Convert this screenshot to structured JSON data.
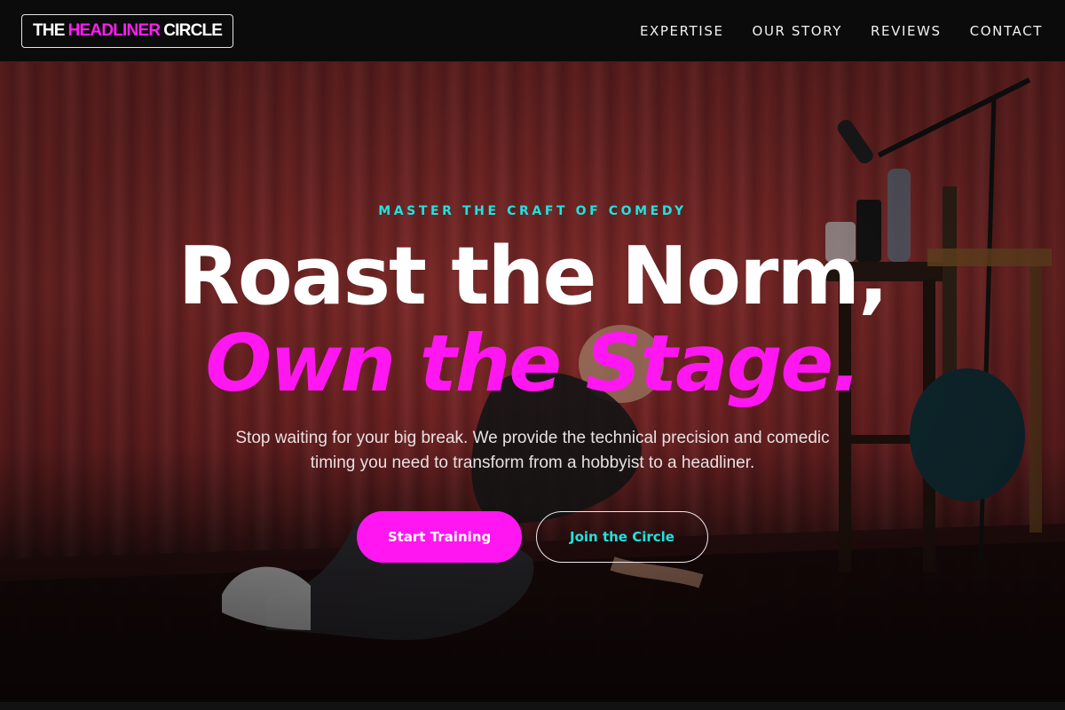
{
  "nav": {
    "logo": {
      "part1": "THE",
      "part2": "HEADLINER",
      "part3": "CIRCLE"
    },
    "items": [
      {
        "label": "EXPERTISE"
      },
      {
        "label": "OUR STORY"
      },
      {
        "label": "REVIEWS"
      },
      {
        "label": "CONTACT"
      }
    ]
  },
  "hero": {
    "eyebrow": "MASTER THE CRAFT OF COMEDY",
    "headline_line1": "Roast the Norm,",
    "headline_line2": "Own the Stage.",
    "subtitle": "Stop waiting for your big break. We provide the technical precision and comedic timing you need to transform from a hobbyist to a headliner.",
    "primary_button": "Start Training",
    "secondary_button": "Join the Circle"
  },
  "colors": {
    "accent_magenta": "#ff16f0",
    "accent_cyan": "#1fe3e0",
    "background": "#0a0a0a"
  },
  "icons": {
    "hero_background": "stage-performer-photo"
  }
}
